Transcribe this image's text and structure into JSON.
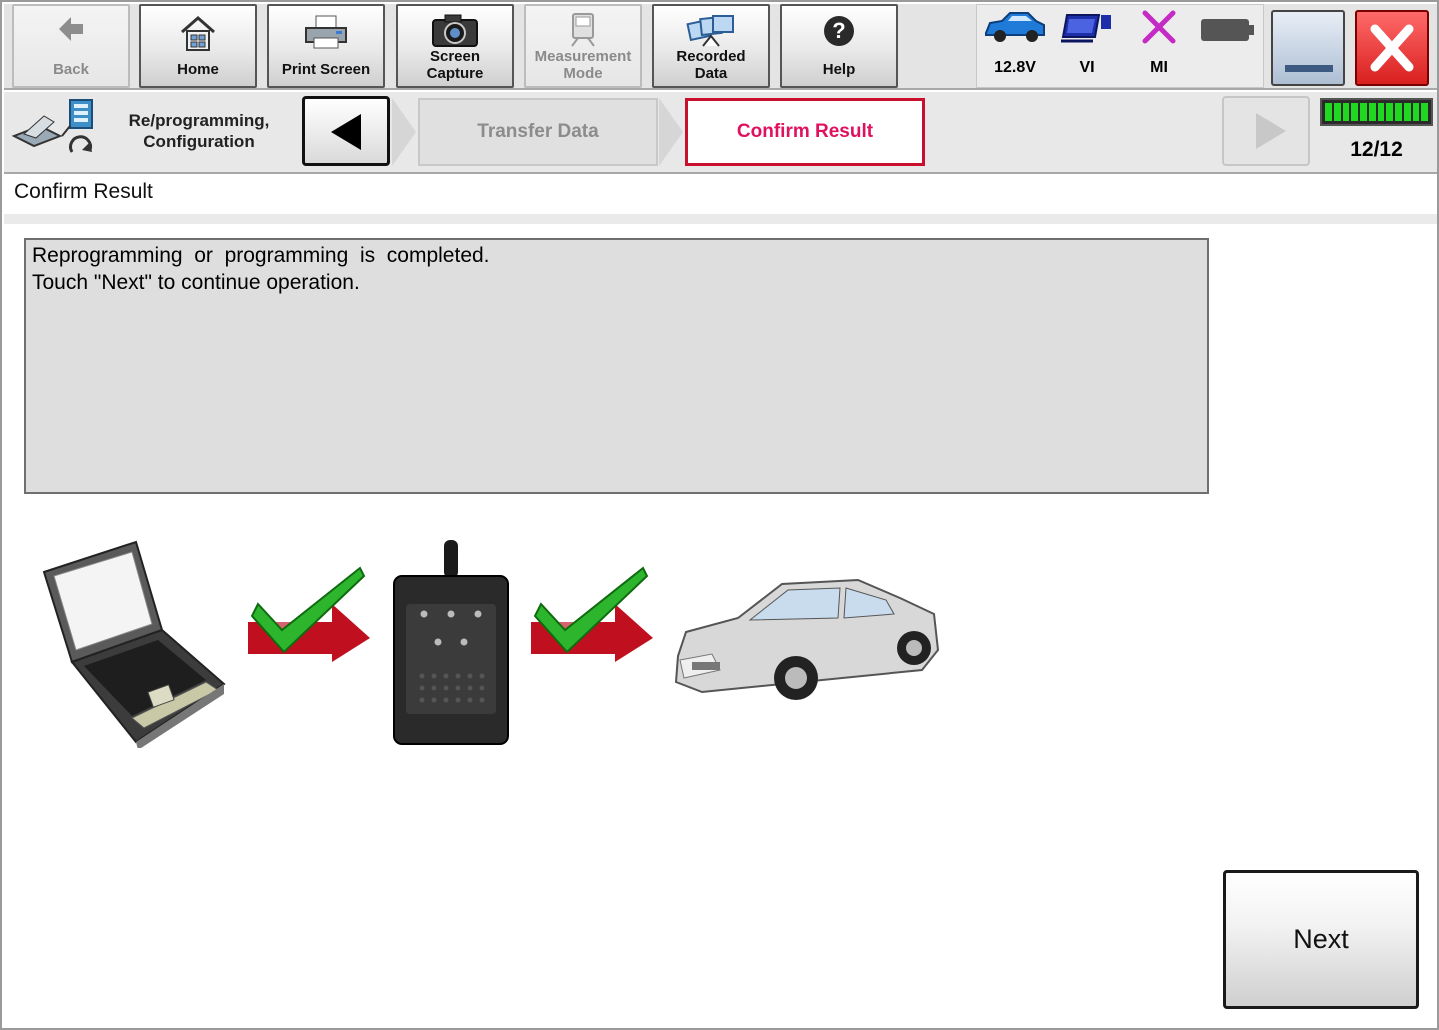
{
  "toolbar": {
    "back_label": "Back",
    "home_label": "Home",
    "print_label": "Print Screen",
    "capture_label_1": "Screen",
    "capture_label_2": "Capture",
    "measurement_label_1": "Measurement",
    "measurement_label_2": "Mode",
    "recorded_label_1": "Recorded",
    "recorded_label_2": "Data",
    "help_label": "Help"
  },
  "status": {
    "voltage": "12.8V",
    "vi_label": "VI",
    "mi_label": "MI"
  },
  "nav": {
    "module_title_1": "Re/programming,",
    "module_title_2": "Configuration",
    "step_prev": "Transfer Data",
    "step_current": "Confirm Result",
    "page_counter": "12/12",
    "progress_fraction": 1.0
  },
  "main": {
    "title": "Confirm Result",
    "message_line_1": "Reprogramming  or  programming  is  completed.",
    "message_line_2": "Touch \"Next\" to continue operation.",
    "next_label": "Next"
  },
  "colors": {
    "accent_red": "#c8102e",
    "current_step_text": "#e0115f",
    "progress_green": "#21d821",
    "check_green": "#2db52d",
    "arrow_red": "#c01020"
  }
}
